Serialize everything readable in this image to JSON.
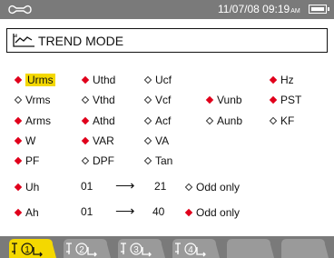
{
  "status_bar": {
    "datetime": "11/07/08 09:19",
    "am": "AM",
    "icon": "wrench-icon",
    "battery": "battery-icon"
  },
  "title": {
    "icon": "trend-icon",
    "text": "TREND MODE"
  },
  "params": [
    {
      "label": "Urms",
      "selected": true,
      "highlighted": true
    },
    {
      "label": "Uthd",
      "selected": true
    },
    {
      "label": "Ucf",
      "selected": false
    },
    {
      "label": "Hz",
      "selected": true
    },
    {
      "label": "Vrms",
      "selected": false
    },
    {
      "label": "Vthd",
      "selected": false
    },
    {
      "label": "Vcf",
      "selected": false
    },
    {
      "label": "Vunb",
      "selected": true
    },
    {
      "label": "PST",
      "selected": true
    },
    {
      "label": "Arms",
      "selected": true
    },
    {
      "label": "Athd",
      "selected": true
    },
    {
      "label": "Acf",
      "selected": false
    },
    {
      "label": "Aunb",
      "selected": false
    },
    {
      "label": "KF",
      "selected": false
    },
    {
      "label": "W",
      "selected": true
    },
    {
      "label": "VAR",
      "selected": true
    },
    {
      "label": "VA",
      "selected": false
    },
    {
      "label": "PF",
      "selected": true
    },
    {
      "label": "DPF",
      "selected": false
    },
    {
      "label": "Tan",
      "selected": false
    }
  ],
  "harmonics": [
    {
      "label": "Uh",
      "selected": true,
      "from": "01",
      "arrow": "⟶",
      "to": "21",
      "odd_label": "Odd only",
      "odd_selected": false
    },
    {
      "label": "Ah",
      "selected": true,
      "from": "01",
      "arrow": "⟶",
      "to": "40",
      "odd_label": "Odd only",
      "odd_selected": true
    }
  ],
  "tabs": [
    {
      "name": "config-1",
      "number": "1",
      "active": true
    },
    {
      "name": "config-2",
      "number": "2",
      "active": false
    },
    {
      "name": "config-3",
      "number": "3",
      "active": false
    },
    {
      "name": "config-4",
      "number": "4",
      "active": false
    },
    {
      "name": "empty-5",
      "number": "",
      "active": false
    },
    {
      "name": "empty-6",
      "number": "",
      "active": false
    }
  ],
  "colors": {
    "selected_mark": "#e0001b",
    "highlight": "#f4d800",
    "bar_gray": "#7a7a7a",
    "tab_active": "#f4d800",
    "tab_inactive": "#9a9a9a"
  }
}
